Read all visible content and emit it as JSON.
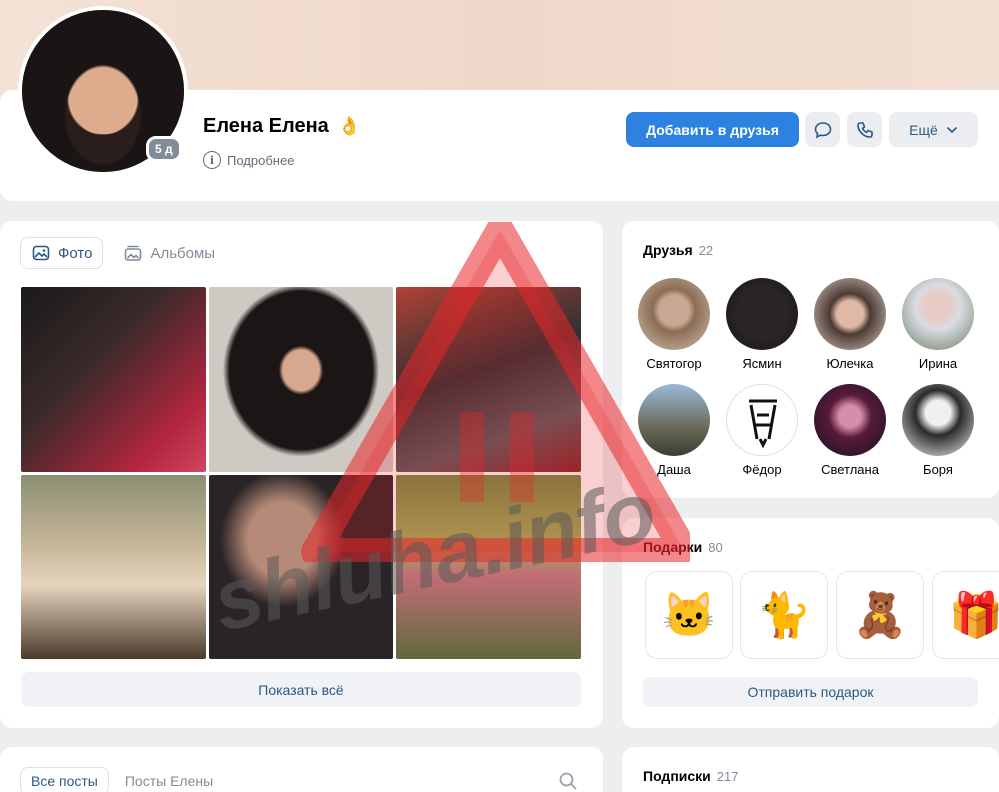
{
  "profile": {
    "name": "Елена Елена",
    "emoji": "👌",
    "online_badge": "5 д",
    "details_label": "Подробнее",
    "add_friend_label": "Добавить в друзья",
    "more_label": "Ещё"
  },
  "photos": {
    "tabs": [
      {
        "label": "Фото",
        "icon": "photo-icon"
      },
      {
        "label": "Альбомы",
        "icon": "album-icon"
      }
    ],
    "show_all_label": "Показать всё"
  },
  "friends": {
    "title": "Друзья",
    "count": "22",
    "items": [
      {
        "name": "Святогор"
      },
      {
        "name": "Ясмин"
      },
      {
        "name": "Юлечка"
      },
      {
        "name": "Ирина"
      },
      {
        "name": "Даша"
      },
      {
        "name": "Фёдор"
      },
      {
        "name": "Светлана"
      },
      {
        "name": "Боря"
      }
    ]
  },
  "gifts": {
    "title": "Подарки",
    "count": "80",
    "items": [
      "🐱",
      "🐈",
      "🧸",
      "🎁"
    ],
    "send_label": "Отправить подарок"
  },
  "posts": {
    "tabs": [
      "Все посты",
      "Посты Елены"
    ]
  },
  "subscriptions": {
    "title": "Подписки",
    "count": "217"
  },
  "watermark": {
    "text": "shluha.info",
    "color": "#e8262a"
  },
  "colors": {
    "primary": "#2d81e0",
    "link": "#2a5885",
    "secondary_text": "#818c99"
  }
}
